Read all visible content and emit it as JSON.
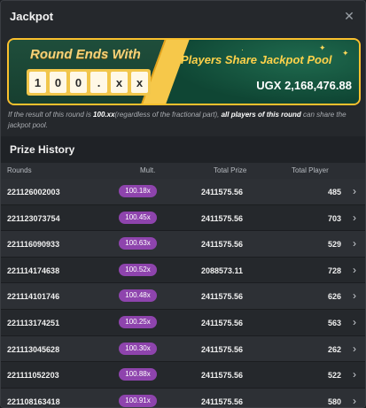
{
  "dialog": {
    "title": "Jackpot"
  },
  "banner": {
    "round_label": "Round Ends With",
    "digits": [
      "1",
      "0",
      "0",
      ".",
      "x",
      "x"
    ],
    "players_share": "Players Share Jackpot Pool",
    "pool_amount": "UGX 2,168,476.88"
  },
  "note": {
    "part1": "If the result of this round is ",
    "bold1": "100.xx",
    "part2": "(regardless of the fractional part), ",
    "bold2": "all players of this round",
    "part3": " can share the jackpot pool."
  },
  "prize_history": {
    "title": "Prize History",
    "columns": {
      "rounds": "Rounds",
      "mult": "Mult.",
      "total_prize": "Total Prize",
      "total_player": "Total Player"
    },
    "rows": [
      {
        "round": "221126002003",
        "mult": "100.18x",
        "prize": "2411575.56",
        "players": "485"
      },
      {
        "round": "221123073754",
        "mult": "100.45x",
        "prize": "2411575.56",
        "players": "703"
      },
      {
        "round": "221116090933",
        "mult": "100.63x",
        "prize": "2411575.56",
        "players": "529"
      },
      {
        "round": "221114174638",
        "mult": "100.52x",
        "prize": "2088573.11",
        "players": "728"
      },
      {
        "round": "221114101746",
        "mult": "100.48x",
        "prize": "2411575.56",
        "players": "626"
      },
      {
        "round": "221113174251",
        "mult": "100.25x",
        "prize": "2411575.56",
        "players": "563"
      },
      {
        "round": "221113045628",
        "mult": "100.30x",
        "prize": "2411575.56",
        "players": "262"
      },
      {
        "round": "221111052203",
        "mult": "100.88x",
        "prize": "2411575.56",
        "players": "522"
      },
      {
        "round": "221108163418",
        "mult": "100.91x",
        "prize": "2411575.56",
        "players": "580"
      }
    ]
  },
  "colors": {
    "accent": "#8e44ad",
    "banner_gold": "#fbc02d",
    "banner_green": "#175c44"
  },
  "icons": {
    "close": "close-icon",
    "row_chevron": "chevron-right-icon"
  }
}
